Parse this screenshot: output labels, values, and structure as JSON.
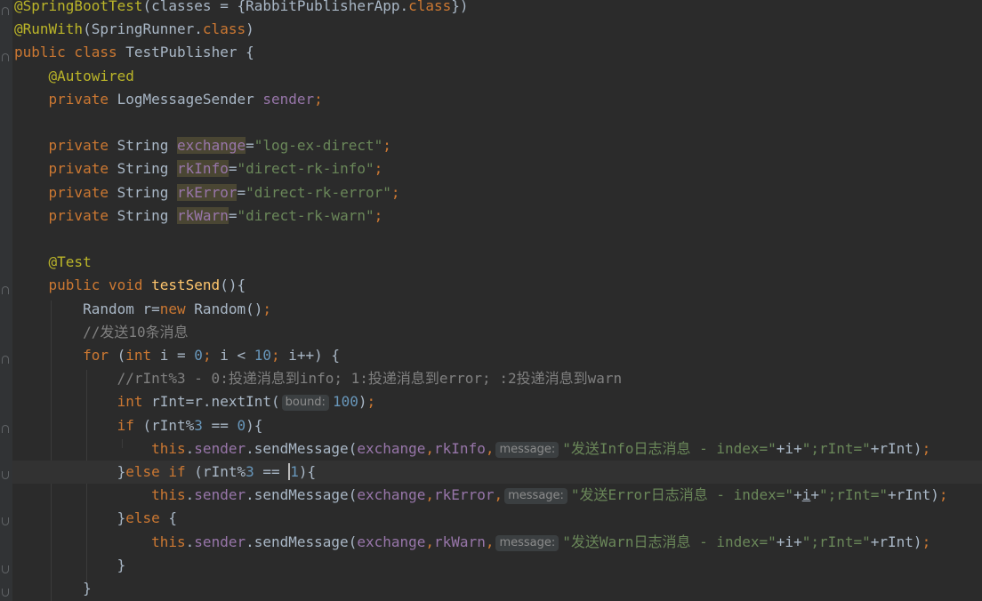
{
  "editor": {
    "lines": [
      {
        "current": false,
        "tokens": [
          {
            "t": "@SpringBootTest",
            "c": "anno"
          },
          {
            "t": "(classes = {RabbitPublisherApp.",
            "c": "plain"
          },
          {
            "t": "class",
            "c": "kw"
          },
          {
            "t": "})",
            "c": "plain"
          }
        ]
      },
      {
        "current": false,
        "tokens": [
          {
            "t": "@RunWith",
            "c": "anno"
          },
          {
            "t": "(SpringRunner.",
            "c": "plain"
          },
          {
            "t": "class",
            "c": "kw"
          },
          {
            "t": ")",
            "c": "plain"
          }
        ]
      },
      {
        "current": false,
        "tokens": [
          {
            "t": "public class ",
            "c": "kw"
          },
          {
            "t": "TestPublisher {",
            "c": "plain"
          }
        ]
      },
      {
        "current": false,
        "tokens": [
          {
            "t": "    "
          },
          {
            "t": "@Autowired",
            "c": "anno"
          }
        ]
      },
      {
        "current": false,
        "tokens": [
          {
            "t": "    "
          },
          {
            "t": "private ",
            "c": "kw"
          },
          {
            "t": "LogMessageSender ",
            "c": "plain"
          },
          {
            "t": "sender",
            "c": "fld"
          },
          {
            "t": ";",
            "c": "kw"
          }
        ]
      },
      {
        "current": false,
        "tokens": []
      },
      {
        "current": false,
        "tokens": [
          {
            "t": "    "
          },
          {
            "t": "private ",
            "c": "kw"
          },
          {
            "t": "String ",
            "c": "plain"
          },
          {
            "t": "exchange",
            "c": "hl"
          },
          {
            "t": "=",
            "c": "plain"
          },
          {
            "t": "\"log-ex-direct\"",
            "c": "str"
          },
          {
            "t": ";",
            "c": "kw"
          }
        ]
      },
      {
        "current": false,
        "tokens": [
          {
            "t": "    "
          },
          {
            "t": "private ",
            "c": "kw"
          },
          {
            "t": "String ",
            "c": "plain"
          },
          {
            "t": "rkInfo",
            "c": "hl"
          },
          {
            "t": "=",
            "c": "plain"
          },
          {
            "t": "\"direct-rk-info\"",
            "c": "str"
          },
          {
            "t": ";",
            "c": "kw"
          }
        ]
      },
      {
        "current": false,
        "tokens": [
          {
            "t": "    "
          },
          {
            "t": "private ",
            "c": "kw"
          },
          {
            "t": "String ",
            "c": "plain"
          },
          {
            "t": "rkError",
            "c": "hl"
          },
          {
            "t": "=",
            "c": "plain"
          },
          {
            "t": "\"direct-rk-error\"",
            "c": "str"
          },
          {
            "t": ";",
            "c": "kw"
          }
        ]
      },
      {
        "current": false,
        "tokens": [
          {
            "t": "    "
          },
          {
            "t": "private ",
            "c": "kw"
          },
          {
            "t": "String ",
            "c": "plain"
          },
          {
            "t": "rkWarn",
            "c": "hl"
          },
          {
            "t": "=",
            "c": "plain"
          },
          {
            "t": "\"direct-rk-warn\"",
            "c": "str"
          },
          {
            "t": ";",
            "c": "kw"
          }
        ]
      },
      {
        "current": false,
        "tokens": []
      },
      {
        "current": false,
        "tokens": [
          {
            "t": "    "
          },
          {
            "t": "@Test",
            "c": "anno"
          }
        ]
      },
      {
        "current": false,
        "tokens": [
          {
            "t": "    "
          },
          {
            "t": "public void ",
            "c": "kw"
          },
          {
            "t": "testSend",
            "c": "fn"
          },
          {
            "t": "(){",
            "c": "plain"
          }
        ]
      },
      {
        "current": false,
        "tokens": [
          {
            "t": "        "
          },
          {
            "t": "Random r=",
            "c": "plain"
          },
          {
            "t": "new ",
            "c": "kw"
          },
          {
            "t": "Random()",
            "c": "plain"
          },
          {
            "t": ";",
            "c": "kw"
          }
        ]
      },
      {
        "current": false,
        "tokens": [
          {
            "t": "        "
          },
          {
            "t": "//发送10条消息",
            "c": "cmt"
          }
        ]
      },
      {
        "current": false,
        "tokens": [
          {
            "t": "        "
          },
          {
            "t": "for ",
            "c": "kw"
          },
          {
            "t": "(",
            "c": "plain"
          },
          {
            "t": "int ",
            "c": "kw"
          },
          {
            "t": "i = ",
            "c": "plain"
          },
          {
            "t": "0",
            "c": "num"
          },
          {
            "t": "; ",
            "c": "kw"
          },
          {
            "t": "i < ",
            "c": "plain"
          },
          {
            "t": "10",
            "c": "num"
          },
          {
            "t": "; ",
            "c": "kw"
          },
          {
            "t": "i++) {",
            "c": "plain"
          }
        ]
      },
      {
        "current": false,
        "tokens": [
          {
            "t": "            "
          },
          {
            "t": "//rInt%3 - 0:投递消息到info; 1:投递消息到error; :2投递消息到warn",
            "c": "cmt"
          }
        ]
      },
      {
        "current": false,
        "tokens": [
          {
            "t": "            "
          },
          {
            "t": "int ",
            "c": "kw"
          },
          {
            "t": "rInt=r.nextInt(",
            "c": "plain"
          },
          {
            "t": "bound:",
            "c": "hint"
          },
          {
            "t": "100",
            "c": "num"
          },
          {
            "t": ")",
            "c": "plain"
          },
          {
            "t": ";",
            "c": "kw"
          }
        ]
      },
      {
        "current": false,
        "tokens": [
          {
            "t": "            "
          },
          {
            "t": "if ",
            "c": "kw"
          },
          {
            "t": "(rInt%",
            "c": "plain"
          },
          {
            "t": "3",
            "c": "num"
          },
          {
            "t": " == ",
            "c": "plain"
          },
          {
            "t": "0",
            "c": "num"
          },
          {
            "t": "){",
            "c": "plain"
          }
        ]
      },
      {
        "current": false,
        "tokens": [
          {
            "t": "                "
          },
          {
            "t": "this",
            "c": "kw"
          },
          {
            "t": ".",
            "c": "plain"
          },
          {
            "t": "sender",
            "c": "fld"
          },
          {
            "t": ".sendMessage(",
            "c": "plain"
          },
          {
            "t": "exchange",
            "c": "fld"
          },
          {
            "t": ",",
            "c": "kw"
          },
          {
            "t": "rkInfo",
            "c": "fld"
          },
          {
            "t": ",",
            "c": "kw"
          },
          {
            "t": "message:",
            "c": "hint"
          },
          {
            "t": "\"发送Info日志消息 - index=\"",
            "c": "str"
          },
          {
            "t": "+",
            "c": "plain"
          },
          {
            "t": "i",
            "c": "plain"
          },
          {
            "t": "+",
            "c": "plain"
          },
          {
            "t": "\";rInt=\"",
            "c": "str"
          },
          {
            "t": "+rInt)",
            "c": "plain"
          },
          {
            "t": ";",
            "c": "kw"
          }
        ]
      },
      {
        "current": true,
        "tokens": [
          {
            "t": "            "
          },
          {
            "t": "}",
            "c": "plain"
          },
          {
            "t": "else if ",
            "c": "kw"
          },
          {
            "t": "(rInt%",
            "c": "plain"
          },
          {
            "t": "3",
            "c": "num"
          },
          {
            "t": " == ",
            "c": "plain"
          },
          {
            "t": "1",
            "c": "caretnum"
          },
          {
            "t": "){",
            "c": "plain"
          }
        ]
      },
      {
        "current": false,
        "tokens": [
          {
            "t": "                "
          },
          {
            "t": "this",
            "c": "kw"
          },
          {
            "t": ".",
            "c": "plain"
          },
          {
            "t": "sender",
            "c": "fld"
          },
          {
            "t": ".sendMessage(",
            "c": "plain"
          },
          {
            "t": "exchange",
            "c": "fld"
          },
          {
            "t": ",",
            "c": "kw"
          },
          {
            "t": "rkError",
            "c": "fld"
          },
          {
            "t": ",",
            "c": "kw"
          },
          {
            "t": "message:",
            "c": "hint"
          },
          {
            "t": "\"发送Error日志消息 - index=\"",
            "c": "str"
          },
          {
            "t": "+",
            "c": "plain"
          },
          {
            "t": "i",
            "c": "ul"
          },
          {
            "t": "+",
            "c": "plain"
          },
          {
            "t": "\";rInt=\"",
            "c": "str"
          },
          {
            "t": "+rInt)",
            "c": "plain"
          },
          {
            "t": ";",
            "c": "kw"
          }
        ]
      },
      {
        "current": false,
        "tokens": [
          {
            "t": "            "
          },
          {
            "t": "}",
            "c": "plain"
          },
          {
            "t": "else ",
            "c": "kw"
          },
          {
            "t": "{",
            "c": "plain"
          }
        ]
      },
      {
        "current": false,
        "tokens": [
          {
            "t": "                "
          },
          {
            "t": "this",
            "c": "kw"
          },
          {
            "t": ".",
            "c": "plain"
          },
          {
            "t": "sender",
            "c": "fld"
          },
          {
            "t": ".sendMessage(",
            "c": "plain"
          },
          {
            "t": "exchange",
            "c": "fld"
          },
          {
            "t": ",",
            "c": "kw"
          },
          {
            "t": "rkWarn",
            "c": "fld"
          },
          {
            "t": ",",
            "c": "kw"
          },
          {
            "t": "message:",
            "c": "hint"
          },
          {
            "t": "\"发送Warn日志消息 - index=\"",
            "c": "str"
          },
          {
            "t": "+",
            "c": "plain"
          },
          {
            "t": "i",
            "c": "plain"
          },
          {
            "t": "+",
            "c": "plain"
          },
          {
            "t": "\";rInt=\"",
            "c": "str"
          },
          {
            "t": "+rInt)",
            "c": "plain"
          },
          {
            "t": ";",
            "c": "kw"
          }
        ]
      },
      {
        "current": false,
        "tokens": [
          {
            "t": "            "
          },
          {
            "t": "}",
            "c": "plain"
          }
        ]
      },
      {
        "current": false,
        "tokens": [
          {
            "t": "        "
          },
          {
            "t": "}",
            "c": "plain"
          }
        ]
      }
    ]
  },
  "colors": {
    "background": "#2b2b2b",
    "keyword": "#cc7832",
    "annotation": "#bbb529",
    "field": "#9876aa",
    "string": "#6a8759",
    "number": "#6897bb",
    "comment": "#808080",
    "method": "#ffc66d",
    "default": "#a9b7c6"
  }
}
